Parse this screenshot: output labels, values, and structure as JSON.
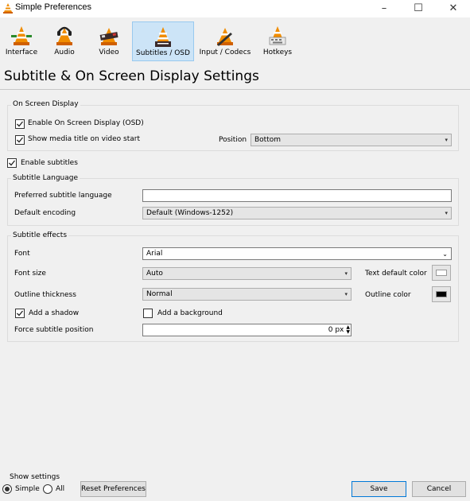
{
  "window": {
    "title": "Simple Preferences",
    "minimize": "–",
    "maximize": "☐",
    "close": "✕"
  },
  "toolbar": {
    "items": [
      {
        "label": "Interface"
      },
      {
        "label": "Audio"
      },
      {
        "label": "Video"
      },
      {
        "label": "Subtitles / OSD"
      },
      {
        "label": "Input / Codecs"
      },
      {
        "label": "Hotkeys"
      }
    ],
    "active_index": 3
  },
  "page_title": "Subtitle & On Screen Display Settings",
  "osd": {
    "group_label": "On Screen Display",
    "enable_osd_label": "Enable On Screen Display (OSD)",
    "enable_osd_checked": true,
    "show_title_label": "Show media title on video start",
    "show_title_checked": true,
    "position_label": "Position",
    "position_value": "Bottom"
  },
  "enable_subtitles": {
    "label": "Enable subtitles",
    "checked": true
  },
  "language": {
    "group_label": "Subtitle Language",
    "preferred_label": "Preferred subtitle language",
    "preferred_value": "",
    "encoding_label": "Default encoding",
    "encoding_value": "Default (Windows-1252)"
  },
  "effects": {
    "group_label": "Subtitle effects",
    "font_label": "Font",
    "font_value": "Arial",
    "font_size_label": "Font size",
    "font_size_value": "Auto",
    "text_color_label": "Text default color",
    "text_color": "#ffffff",
    "outline_thickness_label": "Outline thickness",
    "outline_thickness_value": "Normal",
    "outline_color_label": "Outline color",
    "outline_color": "#000000",
    "shadow_label": "Add a shadow",
    "shadow_checked": true,
    "background_label": "Add a background",
    "background_checked": false,
    "force_position_label": "Force subtitle position",
    "force_position_value": "0 px"
  },
  "footer": {
    "show_settings_label": "Show settings",
    "simple_label": "Simple",
    "all_label": "All",
    "selected": "Simple",
    "reset_label": "Reset Preferences",
    "save_label": "Save",
    "cancel_label": "Cancel"
  },
  "colors": {
    "accent": "#0078d7",
    "active_tab_bg": "#cce4f7",
    "cone_orange": "#f08c00"
  }
}
